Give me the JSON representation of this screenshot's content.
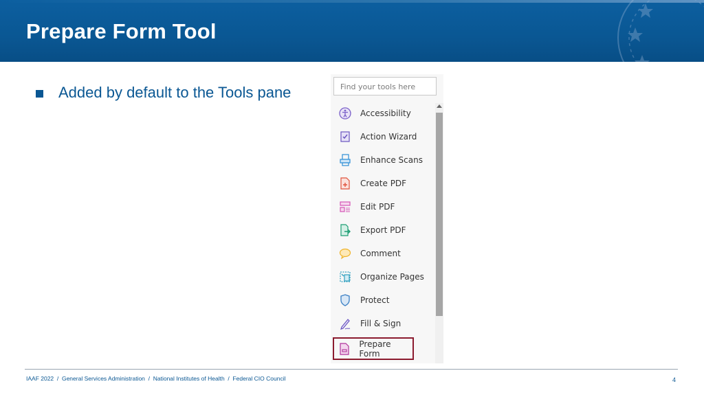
{
  "slide": {
    "title": "Prepare Form Tool",
    "bullet": "Added by default to the Tools pane"
  },
  "tools_pane": {
    "search_placeholder": "Find your tools here",
    "items": [
      {
        "label": "Accessibility",
        "icon": "accessibility-icon",
        "color": "#7b61c9"
      },
      {
        "label": "Action Wizard",
        "icon": "action-wizard-icon",
        "color": "#6a55c0"
      },
      {
        "label": "Enhance Scans",
        "icon": "enhance-scans-icon",
        "color": "#2f8fd6"
      },
      {
        "label": "Create PDF",
        "icon": "create-pdf-icon",
        "color": "#e0533c"
      },
      {
        "label": "Edit PDF",
        "icon": "edit-pdf-icon",
        "color": "#d455b6"
      },
      {
        "label": "Export PDF",
        "icon": "export-pdf-icon",
        "color": "#1e9e74"
      },
      {
        "label": "Comment",
        "icon": "comment-icon",
        "color": "#f0b429"
      },
      {
        "label": "Organize Pages",
        "icon": "organize-pages-icon",
        "color": "#2f9fbf"
      },
      {
        "label": "Protect",
        "icon": "protect-icon",
        "color": "#3b7fc4"
      },
      {
        "label": "Fill & Sign",
        "icon": "fill-sign-icon",
        "color": "#6a55c0"
      },
      {
        "label": "Prepare Form",
        "icon": "prepare-form-icon",
        "color": "#b0339b",
        "selected": true
      }
    ]
  },
  "footer": {
    "text": "IAAF 2022  /  General Services Administration  /  National Institutes of Health  /  Federal CIO Council",
    "page": "4"
  },
  "colors": {
    "header_blue": "#0a5793",
    "selection_border": "#8b1a2e"
  }
}
